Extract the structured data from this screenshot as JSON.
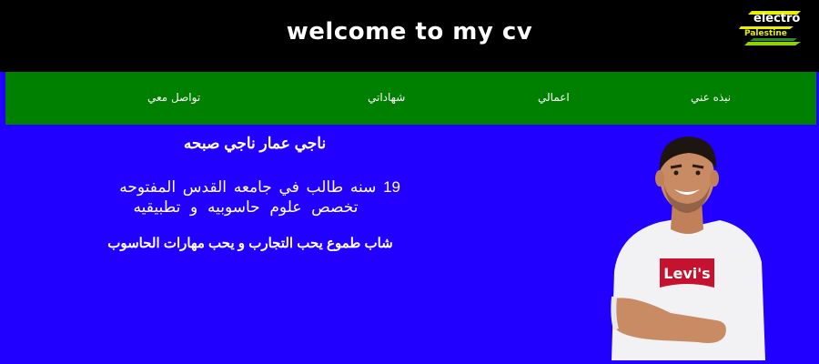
{
  "header": {
    "title": "welcome to my cv",
    "logo": {
      "line1": "electro",
      "line2": "Palestine",
      "icon": "electro-palestine-logo"
    }
  },
  "nav": {
    "items": [
      {
        "label": "نبذه عني"
      },
      {
        "label": "اعمالي"
      },
      {
        "label": "شهاداتي"
      },
      {
        "label": "تواصل معي"
      }
    ]
  },
  "profile": {
    "name": "ناجي عمار ناجي صبحه",
    "bio_line1": "19 سنه طالب في جامعه القدس المفتوحه",
    "bio_line2": "تخصص علوم حاسوبيه و تطبيقيه",
    "tagline": "شاب طموع يحب التجارب و يحب مهارات الحاسوب",
    "photo": "profile-photo",
    "shirt_text": "Levi's"
  },
  "colors": {
    "background": "#2200ff",
    "header": "#000000",
    "nav": "#008000",
    "text": "#ffffff",
    "logo_accent": "#e8f000"
  }
}
